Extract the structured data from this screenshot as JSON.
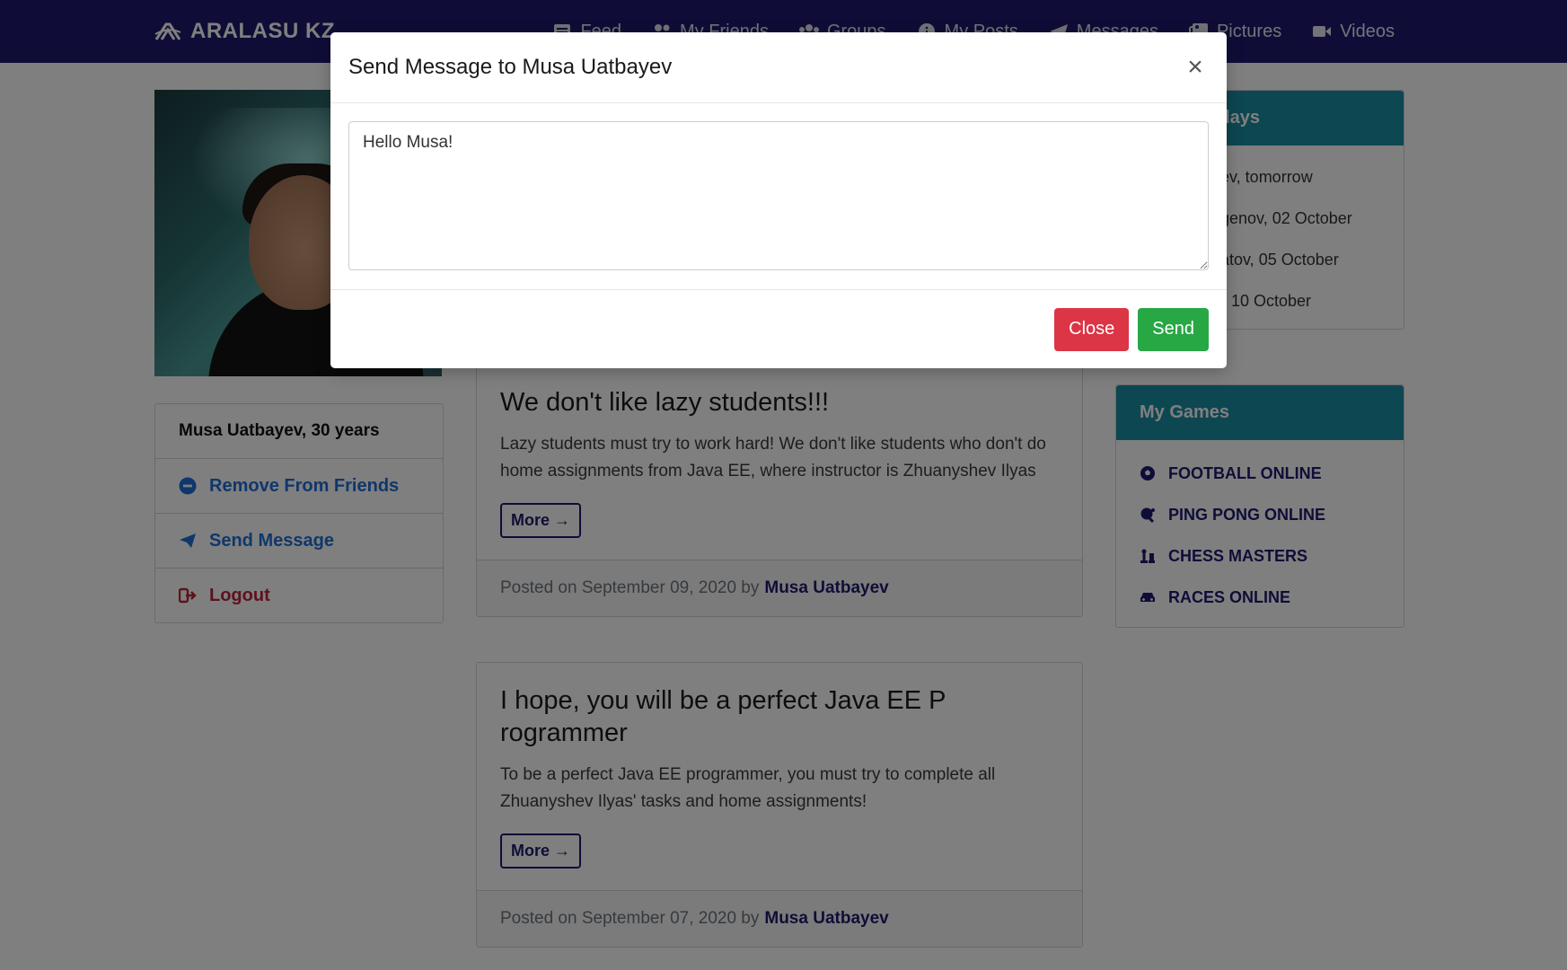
{
  "navbar": {
    "brand": "ARALASU KZ",
    "items": [
      {
        "label": "Feed",
        "icon": "newspaper-icon"
      },
      {
        "label": "My Friends",
        "icon": "users-icon"
      },
      {
        "label": "Groups",
        "icon": "group-icon"
      },
      {
        "label": "My Posts",
        "icon": "info-circle-icon"
      },
      {
        "label": "Messages",
        "icon": "paper-plane-icon"
      },
      {
        "label": "Pictures",
        "icon": "images-icon"
      },
      {
        "label": "Videos",
        "icon": "video-icon"
      }
    ]
  },
  "profile": {
    "name": "Musa Uatbayev, 30 years",
    "remove_friend": "Remove From Friends",
    "send_message": "Send Message",
    "logout": "Logout"
  },
  "posts": [
    {
      "title": "We don't like lazy students!!!",
      "text": "Lazy students must try to work hard! We don't like students who don't do home assignments from Java EE, where instructor is Zhuanyshev Ilyas",
      "more": "More →",
      "posted_prefix": "Posted on September 09, 2020 by",
      "author": "Musa Uatbayev"
    },
    {
      "title": "I hope, you will be a perfect Java EE P rogrammer",
      "text": "To be a perfect Java EE programmer, you must try to complete all Zhuanyshev Ilyas' tasks and home assignments!",
      "more": "More →",
      "posted_prefix": "Posted on September 07, 2020 by",
      "author": "Musa Uatbayev"
    }
  ],
  "birthdays": {
    "title": "hdays",
    "items": [
      "ev, tomorrow",
      "genov, 02 October",
      "atov, 05 October",
      "10 October"
    ]
  },
  "games": {
    "title": "My Games",
    "items": [
      {
        "label": "FOOTBALL ONLINE",
        "icon": "football-icon"
      },
      {
        "label": "PING PONG ONLINE",
        "icon": "table-tennis-icon"
      },
      {
        "label": "CHESS MASTERS",
        "icon": "chess-icon"
      },
      {
        "label": "RACES ONLINE",
        "icon": "car-icon"
      }
    ]
  },
  "modal": {
    "title": "Send Message to Musa Uatbayev",
    "close_symbol": "×",
    "message_value": "Hello Musa!",
    "close_label": "Close",
    "send_label": "Send"
  },
  "colors": {
    "navbar": "#1e1b6f",
    "card_header": "#1b8ea3",
    "close_button": "#dc3545",
    "send_button": "#28a745",
    "link": "#1f6fd6"
  }
}
